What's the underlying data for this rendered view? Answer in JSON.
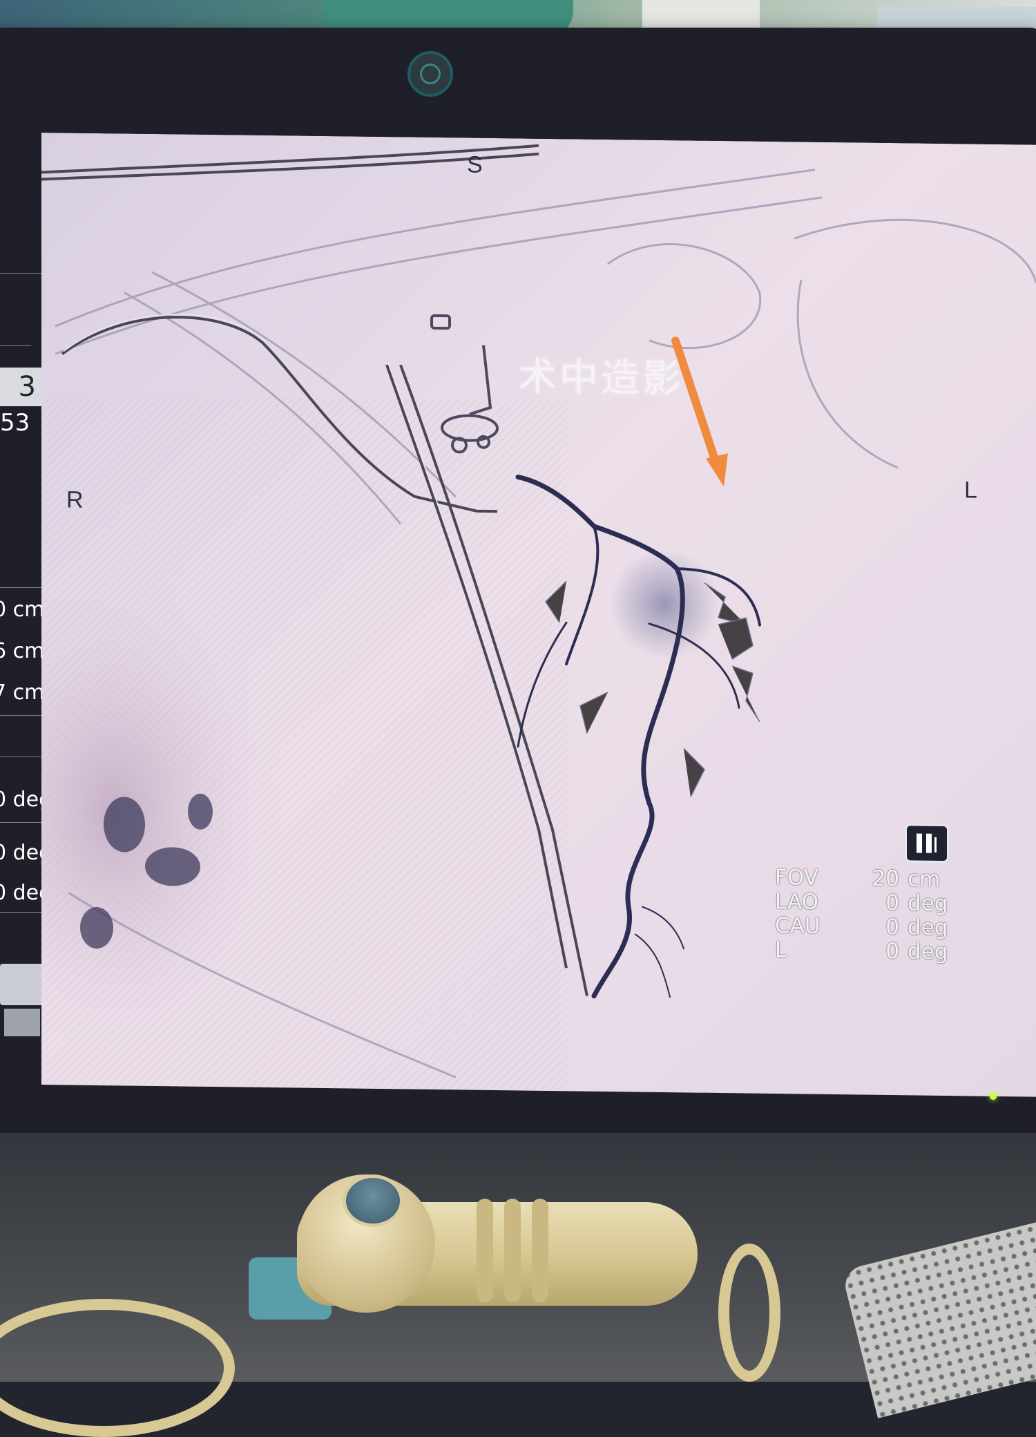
{
  "monitor": {
    "brand_logo": "ge-monogram-icon",
    "accent_color": "#f08a3c"
  },
  "left_panel": {
    "value_box": "3",
    "value_below": "53",
    "rows": [
      "0 cm",
      "6 cm",
      "7 cm",
      "0 deg",
      "0 deg",
      "0 deg"
    ]
  },
  "image": {
    "orientation": {
      "top": "S",
      "left": "R",
      "right": "L"
    },
    "procedure_label": "术中造影",
    "arrow_color": "#f08a3c",
    "info": {
      "rows": [
        {
          "label": "FOV",
          "value": "20",
          "unit": "cm"
        },
        {
          "label": "LAO",
          "value": "0",
          "unit": "deg"
        },
        {
          "label": "CAU",
          "value": "0",
          "unit": "deg"
        },
        {
          "label": "L",
          "value": "0",
          "unit": "deg"
        }
      ]
    },
    "playback_icon": "pause-icon"
  }
}
